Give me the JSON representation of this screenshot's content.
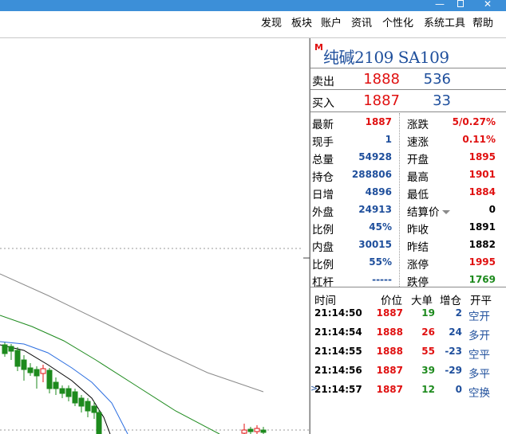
{
  "menu": {
    "items": [
      "发现",
      "板块",
      "账户",
      "资讯",
      "个性化",
      "系统工具",
      "帮助"
    ]
  },
  "window": {
    "minimize_glyph": "—",
    "close_glyph": "✕"
  },
  "quote": {
    "market_badge": "M",
    "title": "纯碱2109  SA109",
    "sell": {
      "label": "卖出",
      "price": "1888",
      "volume": "536"
    },
    "buy": {
      "label": "买入",
      "price": "1887",
      "volume": "33"
    },
    "stats": [
      {
        "k1": "最新",
        "v1": "1887",
        "k2": "涨跌",
        "v2": "5/0.27%"
      },
      {
        "k1": "现手",
        "v1": "1",
        "k2": "速涨",
        "v2": "0.11%"
      },
      {
        "k1": "总量",
        "v1": "54928",
        "k2": "开盘",
        "v2": "1895"
      },
      {
        "k1": "持仓",
        "v1": "288806",
        "k2": "最高",
        "v2": "1901"
      },
      {
        "k1": "日增",
        "v1": "4896",
        "k2": "最低",
        "v2": "1884"
      },
      {
        "k1": "外盘",
        "v1": "24913",
        "k2": "结算价",
        "v2": "0"
      },
      {
        "k1": "比例",
        "v1": "45%",
        "k2": "昨收",
        "v2": "1891"
      },
      {
        "k1": "内盘",
        "v1": "30015",
        "k2": "昨结",
        "v2": "1882"
      },
      {
        "k1": "比例",
        "v1": "55%",
        "k2": "涨停",
        "v2": "1995"
      },
      {
        "k1": "杠杆",
        "v1": "-----",
        "k2": "跌停",
        "v2": "1769"
      }
    ],
    "ticks_header": {
      "time": "时间",
      "price": "价位",
      "big": "大单",
      "oi": "增仓",
      "nature": "开平"
    },
    "ticks": [
      {
        "time": "21:14:50",
        "price": "1887",
        "volume": "19",
        "oi": "2",
        "nature": "空开"
      },
      {
        "time": "21:14:54",
        "price": "1888",
        "volume": "26",
        "oi": "24",
        "nature": "多开"
      },
      {
        "time": "21:14:55",
        "price": "1888",
        "volume": "55",
        "oi": "-23",
        "nature": "空平"
      },
      {
        "time": "21:14:56",
        "price": "1887",
        "volume": "39",
        "oi": "-29",
        "nature": "多平"
      },
      {
        "time": "21:14:57",
        "price": "1887",
        "volume": "12",
        "oi": "0",
        "nature": "空换"
      }
    ],
    "current_marker": ">"
  },
  "colors": {
    "up": "#e01010",
    "down": "#1d8a1d",
    "neutral": "#1f4f9c",
    "candle_down": "#1d8a1d",
    "candle_up": "#e01010",
    "ma_gray": "#8a8a8a",
    "ma_green": "#1d8a1d",
    "ma_blue": "#2a6de0",
    "ma_black": "#000000",
    "title_bar": "#3c8fd8"
  }
}
